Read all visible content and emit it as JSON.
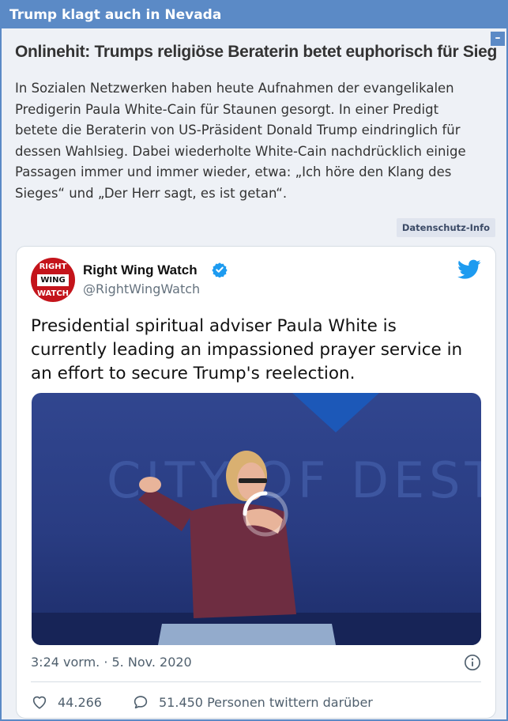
{
  "page": {
    "section_title": "Trump klagt auch in Nevada",
    "collapse_label": "–"
  },
  "article": {
    "headline": "Onlinehit: Trumps religiöse Beraterin betet euphorisch für Sieg",
    "body_lines": [
      "In Sozialen Netzwerken haben heute Aufnahmen der evangelikalen",
      "Predigerin Paula White-Cain für Staunen gesorgt. In einer Predigt",
      "betete die Beraterin von US-Präsident Donald Trump eindringlich für",
      "dessen Wahlsieg. Dabei wiederholte White-Cain nachdrücklich einige",
      "Passagen immer und immer wieder, etwa: „Ich höre den Klang des",
      "Sieges“ und „Der Herr sagt, es ist getan“."
    ],
    "privacy_button": "Datenschutz-Info"
  },
  "tweet": {
    "avatar_text": {
      "top": "RIGHT",
      "middle": "WING",
      "bottom": "WATCH"
    },
    "author_name": "Right Wing Watch",
    "author_handle": "@RightWingWatch",
    "text_lines": [
      "Presidential spiritual adviser Paula White is",
      "currently leading an impassioned prayer service in",
      "an effort to secure Trump's reelection."
    ],
    "video_backdrop_text": "CITY OF DEST",
    "timestamp": "3:24 vorm. · 5. Nov. 2020",
    "likes": "44.266",
    "replies_label": "51.450 Personen twittern darüber"
  },
  "colors": {
    "accent": "#5b8ac6",
    "twitter_blue": "#1d9bf0",
    "avatar_red": "#c4141b"
  },
  "icons": [
    "verified-badge-icon",
    "twitter-bird-icon",
    "info-icon",
    "heart-icon",
    "speech-bubble-icon",
    "loading-spinner-icon"
  ]
}
